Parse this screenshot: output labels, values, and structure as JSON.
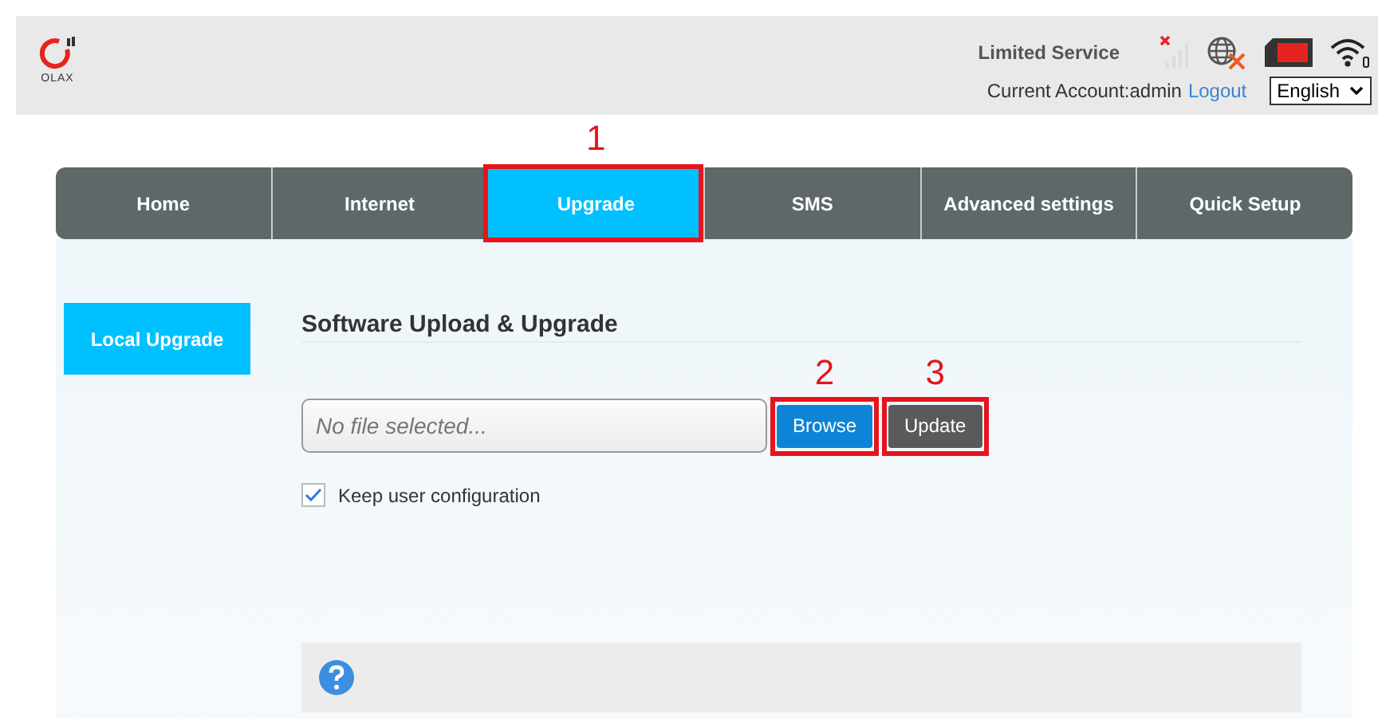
{
  "header": {
    "logo_text": "OLAX",
    "status": "Limited Service",
    "account_label": "Current Account:admin",
    "logout": "Logout",
    "language": "English"
  },
  "tabs": [
    {
      "label": "Home",
      "selected": false
    },
    {
      "label": "Internet",
      "selected": false
    },
    {
      "label": "Upgrade",
      "selected": true,
      "annotation": "1"
    },
    {
      "label": "SMS",
      "selected": false
    },
    {
      "label": "Advanced settings",
      "selected": false
    },
    {
      "label": "Quick Setup",
      "selected": false
    }
  ],
  "sidebar": {
    "items": [
      {
        "label": "Local Upgrade",
        "selected": true
      }
    ]
  },
  "section": {
    "title": "Software Upload & Upgrade",
    "file_field": {
      "placeholder": "No file selected..."
    },
    "buttons": [
      {
        "label": "Browse",
        "kind": "primary",
        "annotation": "2"
      },
      {
        "label": "Update",
        "kind": "secondary",
        "annotation": "3"
      }
    ],
    "keep_config": {
      "label": "Keep user configuration",
      "checked": true
    }
  }
}
